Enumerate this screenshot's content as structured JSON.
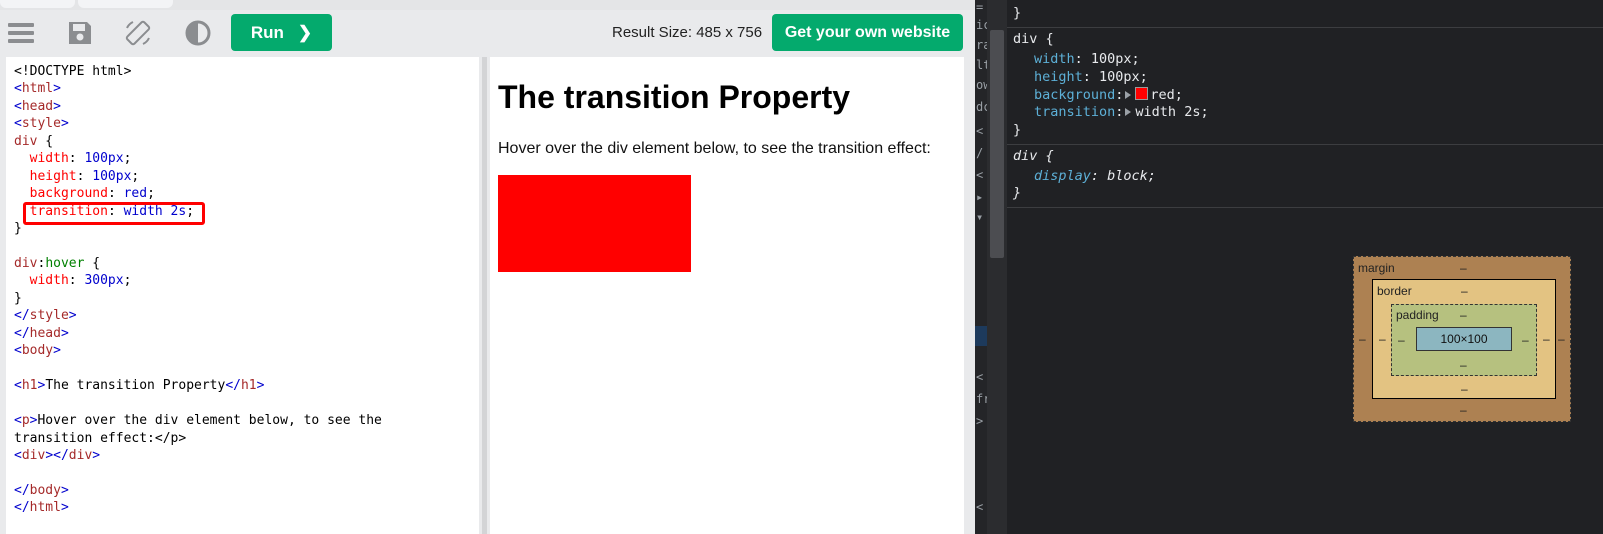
{
  "toolbar": {
    "icons": [
      "menu-icon",
      "save-icon",
      "rotate-icon",
      "contrast-icon"
    ],
    "run_label": "Run",
    "run_chevron": "❯",
    "result_size": "Result Size: 485 x 756",
    "get_website_label": "Get your own website"
  },
  "editor": {
    "lines": [
      "<!DOCTYPE html>",
      "<html>",
      "<head>",
      "<style>",
      "div {",
      "  width: 100px;",
      "  height: 100px;",
      "  background: red;",
      "  transition: width 2s;",
      "}",
      "",
      "div:hover {",
      "  width: 300px;",
      "}",
      "</style>",
      "</head>",
      "<body>",
      "",
      "<h1>The transition Property</h1>",
      "",
      "<p>Hover over the div element below, to see the",
      "transition effect:</p>",
      "<div></div>",
      "",
      "</body>",
      "</html>"
    ],
    "highlighted_line": "transition: width 2s;"
  },
  "result": {
    "heading": "The transition Property",
    "paragraph": "Hover over the div element below, to see the transition effect:",
    "demo_color": "#ff0000"
  },
  "devtools": {
    "left_gutter": [
      "=",
      "ic",
      "ra",
      "lt",
      "ow",
      "dc",
      "<",
      "/",
      "<",
      "▸",
      "▾",
      "<",
      "fr",
      ">",
      "<"
    ],
    "rule0_close": "}",
    "rule1": {
      "selector": "div {",
      "declarations": [
        {
          "prop": "width",
          "value": "100px;"
        },
        {
          "prop": "height",
          "value": "100px;"
        },
        {
          "prop": "background",
          "value": "red;",
          "swatch": "#ff0000"
        },
        {
          "prop": "transition",
          "value": "width 2s;"
        }
      ],
      "close": "}"
    },
    "rule2": {
      "selector": "div {",
      "declarations": [
        {
          "prop": "display",
          "value": "block;"
        }
      ],
      "close": "}"
    },
    "box_model": {
      "margin_label": "margin",
      "border_label": "border",
      "padding_label": "padding",
      "content_size": "100×100",
      "placeholder": "–"
    }
  }
}
